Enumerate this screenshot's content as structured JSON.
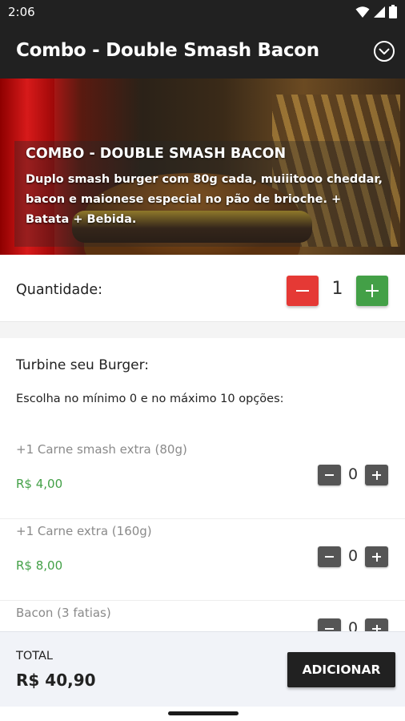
{
  "status_bar": {
    "time": "2:06",
    "icons": [
      "wifi-icon",
      "signal-icon",
      "battery-icon"
    ]
  },
  "app_bar": {
    "title": "Combo - Double Smash Bacon",
    "action_icon": "chevron-down-circle-icon"
  },
  "hero": {
    "heading": "COMBO - DOUBLE SMASH BACON",
    "description": "Duplo smash burger com 80g cada, muiiitooo cheddar, bacon e maionese especial no pão de brioche. + Batata + Bebida."
  },
  "quantity": {
    "label": "Quantidade:",
    "value": "1"
  },
  "addons": {
    "title": "Turbine seu Burger:",
    "rule": "Escolha no mínimo 0 e no máximo 10 opções:",
    "items": [
      {
        "name": "+1 Carne smash extra (80g)",
        "price": "R$ 4,00",
        "count": "0"
      },
      {
        "name": "+1 Carne extra (160g)",
        "price": "R$ 8,00",
        "count": "0"
      },
      {
        "name": "Bacon (3 fatias)",
        "price": "",
        "count": "0"
      }
    ]
  },
  "footer": {
    "total_label": "TOTAL",
    "total_value": "R$ 40,90",
    "add_button": "ADICIONAR"
  },
  "colors": {
    "app_bar": "#212121",
    "minus_red": "#e53935",
    "plus_green": "#43a047",
    "price_green": "#43a047",
    "small_button": "#555555"
  }
}
